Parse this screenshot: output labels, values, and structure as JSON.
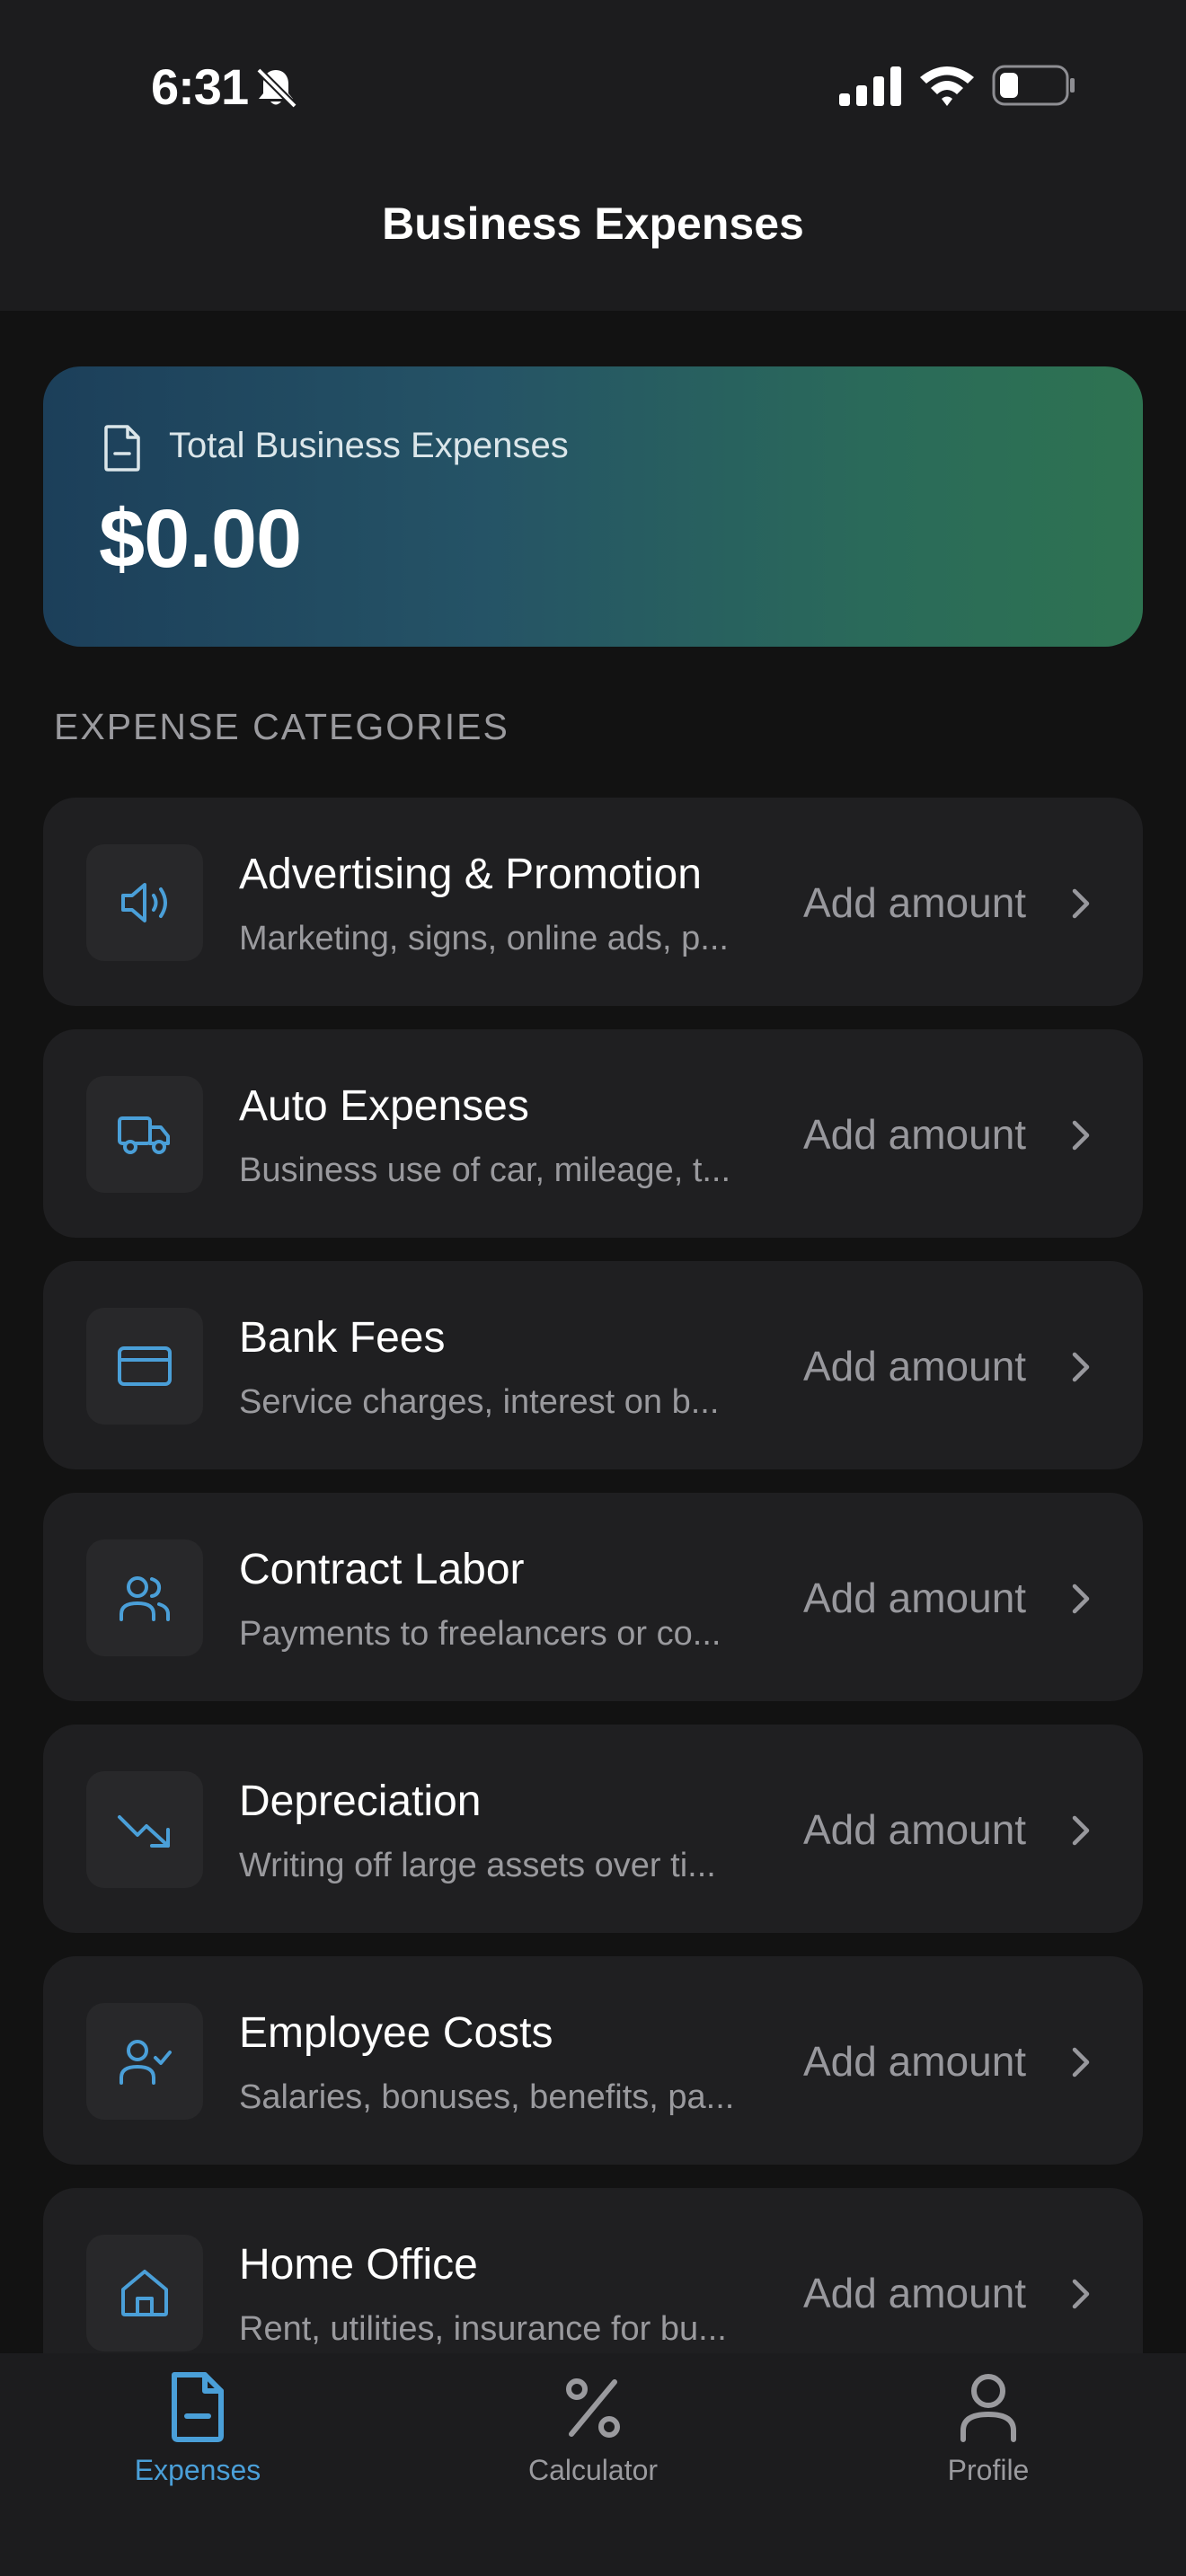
{
  "status_bar": {
    "time": "6:31"
  },
  "header": {
    "title": "Business Expenses"
  },
  "total": {
    "label": "Total Business Expenses",
    "value": "$0.00"
  },
  "section": {
    "title": "EXPENSE CATEGORIES"
  },
  "categories": [
    {
      "name": "Advertising & Promotion",
      "description": "Marketing, signs, online ads, p...",
      "action": "Add amount",
      "icon": "megaphone-icon"
    },
    {
      "name": "Auto Expenses",
      "description": "Business use of car, mileage, t...",
      "action": "Add amount",
      "icon": "truck-icon"
    },
    {
      "name": "Bank Fees",
      "description": "Service charges, interest on b...",
      "action": "Add amount",
      "icon": "credit-card-icon"
    },
    {
      "name": "Contract Labor",
      "description": "Payments to freelancers or co...",
      "action": "Add amount",
      "icon": "users-icon"
    },
    {
      "name": "Depreciation",
      "description": "Writing off large assets over ti...",
      "action": "Add amount",
      "icon": "trending-down-icon"
    },
    {
      "name": "Employee Costs",
      "description": "Salaries, bonuses, benefits, pa...",
      "action": "Add amount",
      "icon": "user-check-icon"
    },
    {
      "name": "Home Office",
      "description": "Rent, utilities, insurance for bu...",
      "action": "Add amount",
      "icon": "home-icon"
    }
  ],
  "tabs": [
    {
      "label": "Expenses",
      "icon": "document-icon",
      "active": true
    },
    {
      "label": "Calculator",
      "icon": "percent-icon",
      "active": false
    },
    {
      "label": "Profile",
      "icon": "user-icon",
      "active": false
    }
  ],
  "colors": {
    "accent": "#4a9fd8",
    "inactive_tab": "#9a9a9e",
    "card_gradient_start": "#1c3f5a",
    "card_gradient_end": "#2e7351"
  }
}
